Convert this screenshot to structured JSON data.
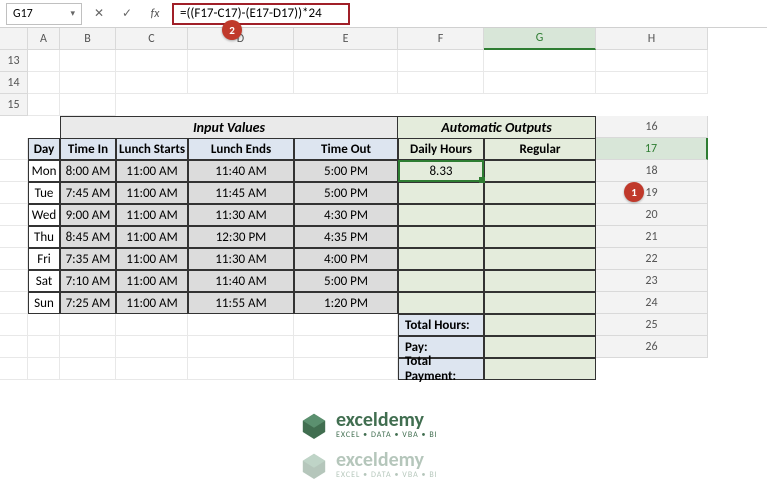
{
  "nameBox": "G17",
  "formula": "=((F17-C17)-(E17-D17))*24",
  "callouts": {
    "one": "1",
    "two": "2"
  },
  "columns": [
    "A",
    "B",
    "C",
    "D",
    "E",
    "F",
    "G",
    "H"
  ],
  "rows": [
    "13",
    "14",
    "15",
    "16",
    "17",
    "18",
    "19",
    "20",
    "21",
    "22",
    "23",
    "24",
    "25",
    "26"
  ],
  "sectionHeaders": {
    "input": "Input Values",
    "output": "Automatic Outputs"
  },
  "headers": {
    "day": "Day",
    "timeIn": "Time In",
    "lunchStarts": "Lunch Starts",
    "lunchEnds": "Lunch Ends",
    "timeOut": "Time Out",
    "dailyHours": "Daily Hours",
    "regular": "Regular"
  },
  "data": [
    {
      "day": "Mon",
      "in": "8:00 AM",
      "ls": "11:00 AM",
      "le": "11:40 AM",
      "out": "5:00 PM",
      "dh": "8.33",
      "reg": ""
    },
    {
      "day": "Tue",
      "in": "7:45 AM",
      "ls": "11:00 AM",
      "le": "11:45 AM",
      "out": "5:00 PM",
      "dh": "",
      "reg": ""
    },
    {
      "day": "Wed",
      "in": "9:00 AM",
      "ls": "11:00 AM",
      "le": "11:30 AM",
      "out": "4:30 PM",
      "dh": "",
      "reg": ""
    },
    {
      "day": "Thu",
      "in": "8:45 AM",
      "ls": "11:00 AM",
      "le": "12:30 PM",
      "out": "4:35 PM",
      "dh": "",
      "reg": ""
    },
    {
      "day": "Fri",
      "in": "7:35 AM",
      "ls": "11:00 AM",
      "le": "11:30 AM",
      "out": "4:00 PM",
      "dh": "",
      "reg": ""
    },
    {
      "day": "Sat",
      "in": "7:10 AM",
      "ls": "11:00 AM",
      "le": "11:40 AM",
      "out": "5:00 PM",
      "dh": "",
      "reg": ""
    },
    {
      "day": "Sun",
      "in": "7:25 AM",
      "ls": "11:00 AM",
      "le": "11:55 AM",
      "out": "1:20 PM",
      "dh": "",
      "reg": ""
    }
  ],
  "summary": {
    "totalHours": "Total Hours:",
    "pay": "Pay:",
    "totalPayment": "Total Payment:"
  },
  "watermark": {
    "brand": "exceldemy",
    "tagline": "EXCEL • DATA • VBA • BI"
  },
  "icons": {
    "dropdown": "▾",
    "cancel": "✕",
    "confirm": "✓",
    "fx": "fx"
  }
}
